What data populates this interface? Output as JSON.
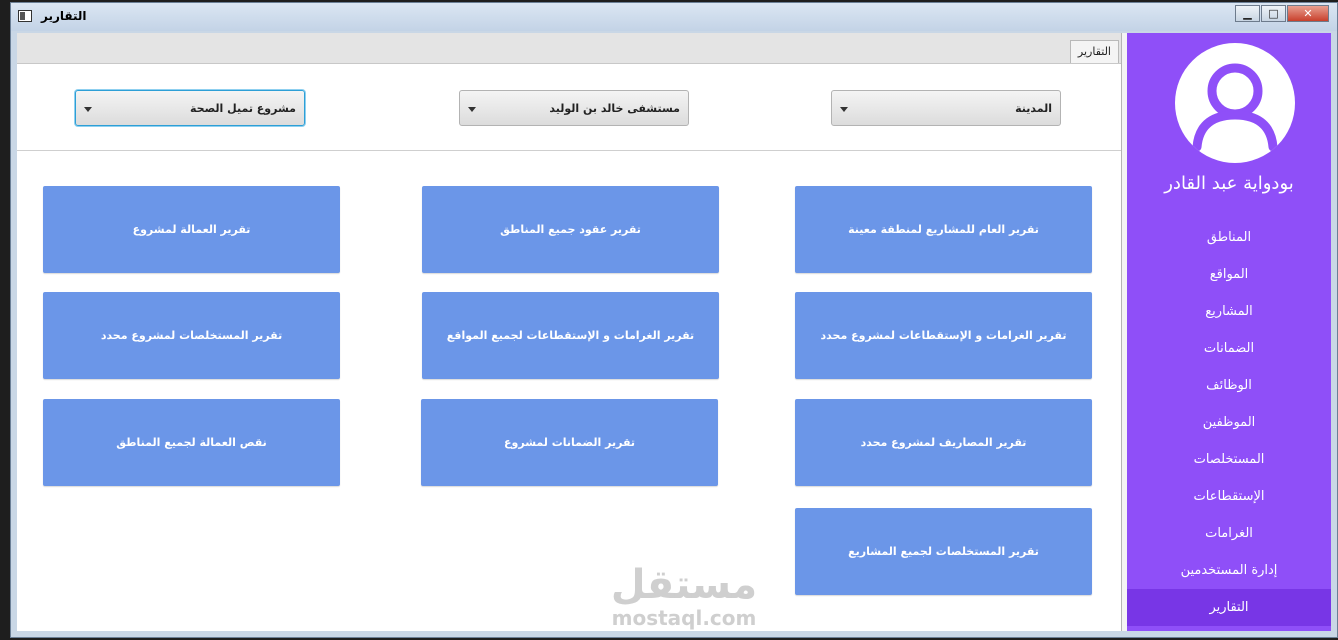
{
  "window": {
    "title": "التقارير",
    "controls": {
      "minimize": "▁",
      "maximize": "□",
      "close": "✕"
    }
  },
  "tab": {
    "label": "التقارير"
  },
  "filters": {
    "city": "المدينة",
    "hospital": "مستشفى خالد بن الوليد",
    "project": "مشروع تميل الصحة"
  },
  "report_buttons": {
    "col_right": [
      "تقرير العام للمشاريع لمنطقة معينة",
      "تقرير الغرامات و الإستقطاعات لمشروع محدد",
      "تقرير المصاريف لمشروع محدد",
      "تقرير المستخلصات لجميع المشاريع"
    ],
    "col_middle": [
      "تقرير عقود جميع المناطق",
      "تقرير الغرامات و الإستقطاعات لجميع المواقع",
      "تقرير الضمانات لمشروع"
    ],
    "col_left": [
      "تقرير العمالة لمشروع",
      "تقرير المستخلصات لمشروع محدد",
      "نقص العمالة لجميع المناطق"
    ]
  },
  "watermark": {
    "arabic": "مستقل",
    "latin": "mostaql.com"
  },
  "sidebar": {
    "user_name": "بودواية عبد القادر",
    "items": [
      "المناطق",
      "المواقع",
      "المشاريع",
      "الضمانات",
      "الوظائف",
      "الموظفين",
      "المستخلصات",
      "الإستقطاعات",
      "الغرامات",
      "إدارة المستخدمين",
      "التقارير"
    ],
    "active_index": 10
  },
  "colors": {
    "sidebar_bg": "#8f4ff8",
    "sidebar_active": "#7836e6",
    "report_button": "#6b96e8"
  }
}
